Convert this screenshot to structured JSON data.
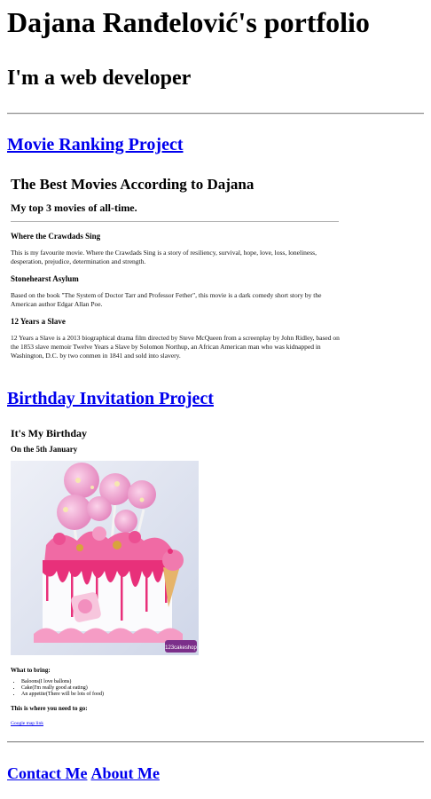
{
  "header": {
    "title": "Dajana Ranđelović's portfolio",
    "tagline": "I'm a web developer"
  },
  "movie_project": {
    "link_label": "Movie Ranking Project",
    "preview": {
      "title": "The Best Movies According to Dajana",
      "subtitle": "My top 3 movies of all-time.",
      "movies": [
        {
          "name": "Where the Crawdads Sing",
          "description": "This is my favourite movie. Where the Crawdads Sing is a story of resiliency, survival, hope, love, loss, loneliness, desperation, prejudice, determination and strength."
        },
        {
          "name": "Stonehearst Asylum",
          "description": "Based on the book \"The System of Doctor Tarr and Professor Fether\", this movie is a dark comedy short story by the American author Edgar Allan Poe."
        },
        {
          "name": "12 Years a Slave",
          "description": "12 Years a Slave is a 2013 biographical drama film directed by Steve McQueen from a screenplay by John Ridley, based on the 1853 slave memoir Twelve Years a Slave by Solomon Northup, an African American man who was kidnapped in Washington, D.C. by two conmen in 1841 and sold into slavery."
        }
      ]
    }
  },
  "birthday_project": {
    "link_label": "Birthday Invitation Project",
    "preview": {
      "title": "It's My Birthday",
      "subtitle": "On the 5th January",
      "image_watermark": "123cakeshop",
      "bring_heading": "What to bring:",
      "bring_items": [
        "Baloons(I love ballons)",
        "Cake(I'm really good at eating)",
        "An appetite(There will be lots of food)"
      ],
      "location_heading": "This is where you need to go:",
      "map_link": "Google map link"
    }
  },
  "footer": {
    "contact_label": "Contact Me",
    "about_label": "About Me"
  },
  "colors": {
    "link": "#0000ee",
    "rule": "#8a8a8a",
    "cake_pink": "#e8307a",
    "cake_bg": "#dfe4f0"
  }
}
